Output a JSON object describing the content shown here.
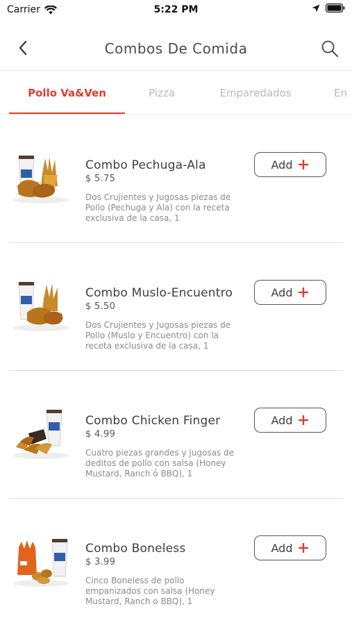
{
  "status_bar": {
    "carrier": "Carrier",
    "time": "5:22 PM"
  },
  "header": {
    "title": "Combos De Comida"
  },
  "tabs": [
    {
      "label": "Pollo Va&Ven",
      "active": true
    },
    {
      "label": "Pizza",
      "active": false
    },
    {
      "label": "Emparedados",
      "active": false
    },
    {
      "label": "En",
      "active": false
    }
  ],
  "products": [
    {
      "name": "Combo Pechuga-Ala",
      "price": "$ 5.75",
      "description": "Dos Crujientes y Jugosas piezas de Pollo (Pechuga y Ala) con la receta exclusiva de la casa, 1",
      "add_label": "Add"
    },
    {
      "name": "Combo Muslo-Encuentro",
      "price": "$ 5.50",
      "description": "Dos Crujientes y Jugosas piezas de Pollo (Muslo y Encuentro) con la receta exclusiva de la casa, 1",
      "add_label": "Add"
    },
    {
      "name": "Combo Chicken Finger",
      "price": "$ 4.99",
      "description": "Cuatro piezas grandes y jugosas de deditos de pollo con salsa (Honey Mustard, Ranch ó BBQ), 1",
      "add_label": "Add"
    },
    {
      "name": "Combo Boneless",
      "price": "$ 3.99",
      "description": "Cinco Boneless de pollo empanizados con salsa (Honey Mustard, Ranch o BBQ), 1",
      "add_label": "Add"
    }
  ],
  "colors": {
    "accent": "#e23b2e",
    "divider": "#dcdcdc"
  },
  "icons": {
    "back": "chevron-left-icon",
    "search": "search-icon",
    "add": "plus-icon"
  }
}
